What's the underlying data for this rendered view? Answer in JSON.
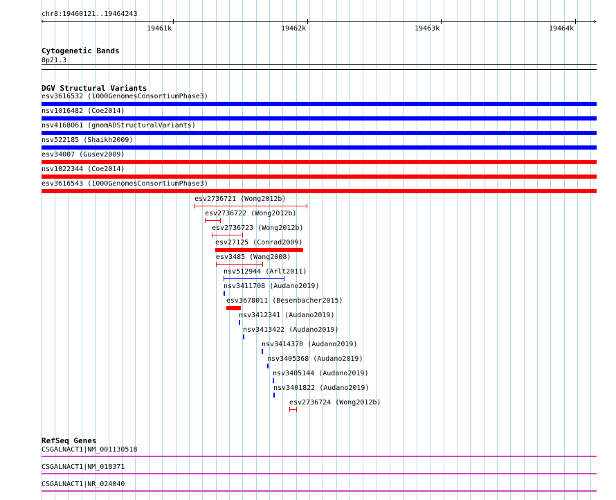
{
  "ruler": {
    "position_label": "chr8:19460121..19464243",
    "ticks": [
      "19461k",
      "19462k",
      "19463k",
      "19464k"
    ]
  },
  "cytoband": {
    "title": "Cytogenetic Bands",
    "band": "8p21.3"
  },
  "dgv": {
    "title": "DGV Structural Variants",
    "colors": {
      "gain": "#0000ff",
      "loss": "#ff0000"
    },
    "full_width_variants": [
      {
        "label": "esv3616532 (1000GenomesConsortiumPhase3)",
        "color": "#0000ff"
      },
      {
        "label": "nsv1016482 (Coe2014)",
        "color": "#0000ff"
      },
      {
        "label": "nsv4168061 (gnomADStructuralVariants)",
        "color": "#0000ff"
      },
      {
        "label": "nsv522185 (Shaikh2009)",
        "color": "#0000ff"
      },
      {
        "label": "esv34007 (Gusev2009)",
        "color": "#ff0000"
      },
      {
        "label": "nsv1022344 (Coe2014)",
        "color": "#ff0000"
      },
      {
        "label": "esv3616543 (1000GenomesConsortiumPhase3)",
        "color": "#ff0000"
      }
    ],
    "local_variants": [
      {
        "label": "esv2736721 (Wong2012b)",
        "color": "#ff0000",
        "style": "thin"
      },
      {
        "label": "esv2736722 (Wong2012b)",
        "color": "#ff0000",
        "style": "thin"
      },
      {
        "label": "esv2736723 (Wong2012b)",
        "color": "#ff0000",
        "style": "thin"
      },
      {
        "label": "esv27125 (Conrad2009)",
        "color": "#ff0000",
        "style": "thick"
      },
      {
        "label": "esv3485 (Wang2008)",
        "color": "#ff0000",
        "style": "thin"
      },
      {
        "label": "nsv512944 (Arlt2011)",
        "color": "#0000ff",
        "style": "thin"
      },
      {
        "label": "nsv3411708 (Audano2019)",
        "color": "#0000ff",
        "style": "dot"
      },
      {
        "label": "esv3678011 (Besenbacher2015)",
        "color": "#ff0000",
        "style": "thick"
      },
      {
        "label": "nsv3412341 (Audano2019)",
        "color": "#0000ff",
        "style": "dot"
      },
      {
        "label": "nsv3413422 (Audano2019)",
        "color": "#0000ff",
        "style": "dot"
      },
      {
        "label": "nsv3414370 (Audano2019)",
        "color": "#0000ff",
        "style": "dot"
      },
      {
        "label": "nsv3405368 (Audano2019)",
        "color": "#0000ff",
        "style": "dot"
      },
      {
        "label": "nsv3405144 (Audano2019)",
        "color": "#0000ff",
        "style": "dot"
      },
      {
        "label": "nsv3401822 (Audano2019)",
        "color": "#0000ff",
        "style": "dot"
      },
      {
        "label": "esv2736724 (Wong2012b)",
        "color": "#ff0000",
        "style": "thin"
      }
    ]
  },
  "refseq": {
    "title": "RefSeq Genes",
    "color": "#cc44cc",
    "genes": [
      {
        "label": "CSGALNACT1|NM_001130518"
      },
      {
        "label": "CSGALNACT1|NM_018371"
      },
      {
        "label": "CSGALNACT1|NR_024040"
      }
    ]
  }
}
